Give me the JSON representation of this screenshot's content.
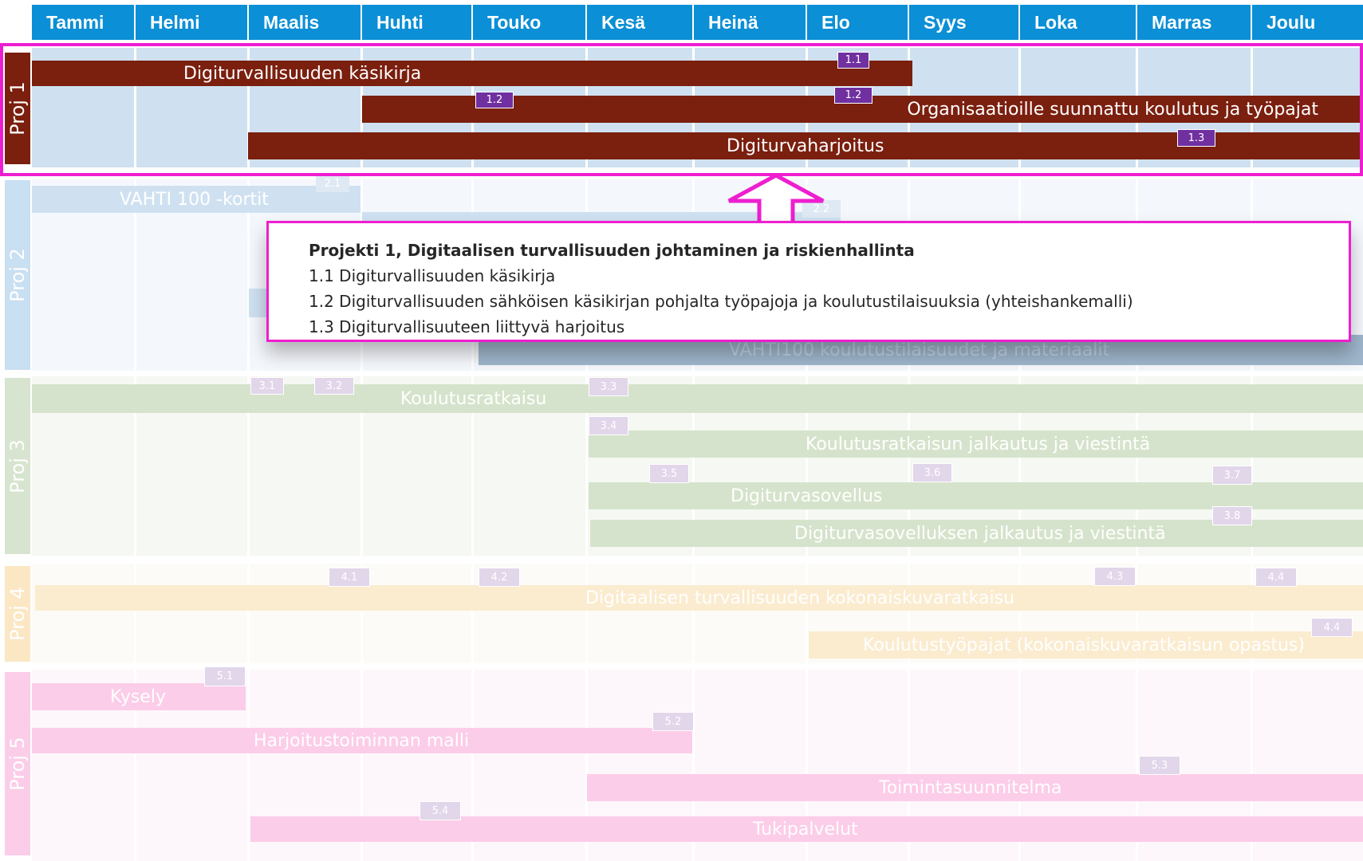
{
  "colors": {
    "header": "#0b8fd6",
    "proj1": "#7b1f0f",
    "proj1_tag": "#7030a0",
    "highlight": "#ee1ed0"
  },
  "months": [
    "Tammi",
    "Helmi",
    "Maalis",
    "Huhti",
    "Touko",
    "Kesä",
    "Heinä",
    "Elo",
    "Syys",
    "Loka",
    "Marras",
    "Joulu"
  ],
  "projects": [
    {
      "label": "Proj 1"
    },
    {
      "label": "Proj 2"
    },
    {
      "label": "Proj 3"
    },
    {
      "label": "Proj 4"
    },
    {
      "label": "Proj 5"
    }
  ],
  "bars": [
    {
      "text": "Digiturvallisuuden käsikirja"
    },
    {
      "text": "Organisaatioille suunnattu koulutus ja työpajat"
    },
    {
      "text": "Digiturvaharjoitus"
    },
    {
      "text": "VAHTI 100 -kortit"
    },
    {
      "text": "VAHTI100 koulutustilaisuudet ja materiaalit"
    },
    {
      "text": "Koulutusratkaisu"
    },
    {
      "text": "Koulutusratkaisun jalkautus ja viestintä"
    },
    {
      "text": "Digiturvasovellus"
    },
    {
      "text": "Digiturvasovelluksen jalkautus ja viestintä"
    },
    {
      "text": "Digitaalisen turvallisuuden kokonaiskuvaratkaisu"
    },
    {
      "text": "Koulutustyöpajat (kokonaiskuvaratkaisun opastus)"
    },
    {
      "text": "Kysely"
    },
    {
      "text": "Harjoitustoiminnan malli"
    },
    {
      "text": "Toimintasuunnitelma"
    },
    {
      "text": "Tukipalvelut"
    }
  ],
  "tags": [
    "1.1",
    "1.2",
    "1.2",
    "1.3",
    "2.1",
    "2.2",
    "3.1",
    "3.2",
    "3.3",
    "3.4",
    "3.5",
    "3.6",
    "3.7",
    "3.8",
    "4.1",
    "4.2",
    "4.3",
    "4.4",
    "4.4",
    "5.1",
    "5.2",
    "5.3",
    "5.4"
  ],
  "callout": {
    "title": "Projekti 1, Digitaalisen turvallisuuden johtaminen ja riskienhallinta",
    "lines": [
      "1.1 Digiturvallisuuden käsikirja",
      "1.2 Digiturvallisuuden sähköisen käsikirjan pohjalta työpajoja ja koulutustilaisuuksia (yhteishankemalli)",
      "1.3 Digiturvallisuuteen liittyvä harjoitus"
    ]
  }
}
